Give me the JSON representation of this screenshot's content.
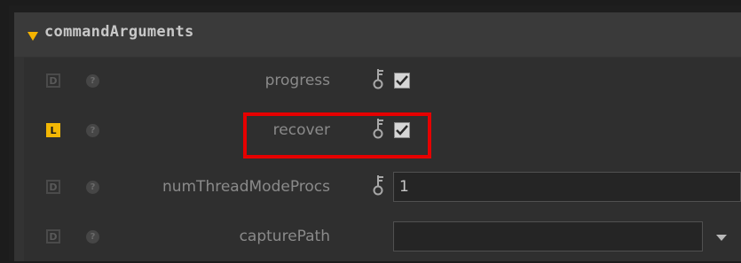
{
  "section": {
    "title": "commandArguments"
  },
  "rows": [
    {
      "badge": "D",
      "help": "?",
      "label": "progress",
      "type": "checkbox",
      "checked": true,
      "locked": false
    },
    {
      "badge": "L",
      "help": "?",
      "label": "recover",
      "type": "checkbox",
      "checked": true,
      "locked": true
    },
    {
      "badge": "D",
      "help": "?",
      "label": "numThreadModeProcs",
      "type": "text",
      "value": "1",
      "locked": false
    },
    {
      "badge": "D",
      "help": "?",
      "label": "capturePath",
      "type": "text-dropdown",
      "value": "",
      "locked": false
    }
  ],
  "colors": {
    "accent": "#f5b400",
    "highlight": "#e60000",
    "panel": "#333333"
  },
  "icons": {
    "collapse": "triangle-down-icon",
    "key": "key-icon",
    "help": "question-icon",
    "check": "checkmark-icon",
    "dropdown": "chevron-down-icon"
  }
}
